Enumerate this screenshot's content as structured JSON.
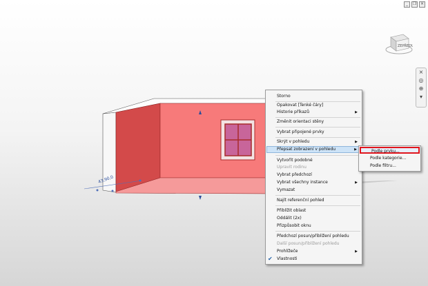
{
  "viewcube": {
    "face_label": "ZEPŘEDU"
  },
  "dimension": {
    "value": "43,90,0"
  },
  "context_menu": {
    "items": [
      {
        "label": "Storno",
        "has_submenu": false,
        "disabled": false
      },
      {
        "label": "Opakovat [Tenké čáry]",
        "has_submenu": false,
        "disabled": false
      },
      {
        "label": "Historie příkazů",
        "has_submenu": true,
        "disabled": false
      },
      {
        "label": "Změnit orientaci stěny",
        "has_submenu": false,
        "disabled": false
      },
      {
        "label": "Vybrat připojené prvky",
        "has_submenu": false,
        "disabled": false
      },
      {
        "label": "Skrýt v pohledu",
        "has_submenu": true,
        "disabled": false
      },
      {
        "label": "Přepsat zobrazení v pohledu",
        "has_submenu": true,
        "disabled": false,
        "highlighted": true
      },
      {
        "label": "Vytvořit podobné",
        "has_submenu": false,
        "disabled": false
      },
      {
        "label": "Upravit rodinu",
        "has_submenu": false,
        "disabled": true
      },
      {
        "label": "Vybrat předchozí",
        "has_submenu": false,
        "disabled": false
      },
      {
        "label": "Vybrat všechny instance",
        "has_submenu": true,
        "disabled": false
      },
      {
        "label": "Vymazat",
        "has_submenu": false,
        "disabled": false
      },
      {
        "label": "Najít referenční pohled",
        "has_submenu": false,
        "disabled": false
      },
      {
        "label": "Přiblížit oblast",
        "has_submenu": false,
        "disabled": false
      },
      {
        "label": "Oddálit (2x)",
        "has_submenu": false,
        "disabled": false
      },
      {
        "label": "Přizpůsobit oknu",
        "has_submenu": false,
        "disabled": false
      },
      {
        "label": "Předchozí posun/přiblížení pohledu",
        "has_submenu": false,
        "disabled": false
      },
      {
        "label": "Další posun/přiblížení pohledu",
        "has_submenu": false,
        "disabled": true
      },
      {
        "label": "Prohlížeče",
        "has_submenu": true,
        "disabled": false
      },
      {
        "label": "Vlastnosti",
        "has_submenu": false,
        "disabled": false,
        "checked": true
      }
    ]
  },
  "submenu": {
    "items": [
      {
        "label": "Podle prvku...",
        "highlighted": true
      },
      {
        "label": "Podle kategorie..."
      },
      {
        "label": "Podle filtru..."
      }
    ]
  },
  "colors": {
    "wall_fill": "#f77a7a",
    "wall_dark": "#cf3f3f",
    "window_glass": "#c8659a",
    "window_frame": "#a82b2b",
    "submenu_highlight_border": "#e0141c"
  }
}
